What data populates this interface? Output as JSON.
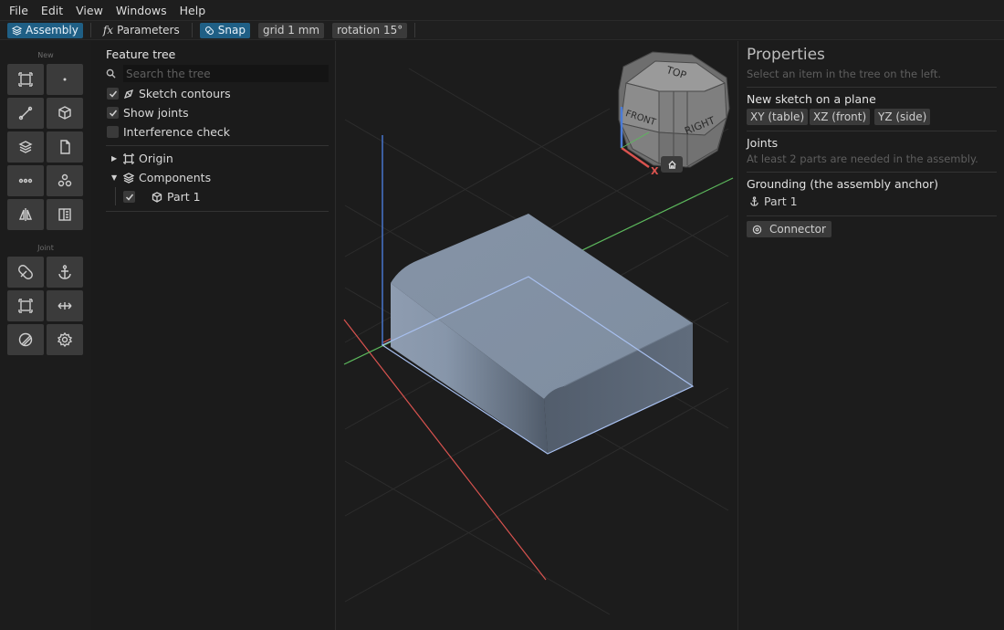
{
  "menu": [
    "File",
    "Edit",
    "View",
    "Windows",
    "Help"
  ],
  "toolbar": {
    "assembly": "Assembly",
    "parameters": "Parameters",
    "snap": "Snap",
    "grid": "grid 1 mm",
    "rotation": "rotation 15°"
  },
  "tools": {
    "section_new": "New",
    "section_joint": "Joint"
  },
  "tree": {
    "title": "Feature tree",
    "search_placeholder": "Search the tree",
    "options": [
      {
        "label": "Sketch contours",
        "checked": true
      },
      {
        "label": "Show joints",
        "checked": true
      },
      {
        "label": "Interference check",
        "checked": false
      }
    ],
    "origin": "Origin",
    "components": "Components",
    "part": "Part 1"
  },
  "viewcube": {
    "top": "TOP",
    "front": "FRONT",
    "right": "RIGHT",
    "x_axis": "X"
  },
  "properties": {
    "title": "Properties",
    "subtitle": "Select an item in the tree on the left.",
    "new_sketch": "New sketch on a plane",
    "planes": [
      "XY (table)",
      "XZ (front)",
      "YZ (side)"
    ],
    "joints_title": "Joints",
    "joints_note": "At least 2 parts are needed in the assembly.",
    "grounding_title": "Grounding (the assembly anchor)",
    "grounding_part": "Part 1",
    "connector": "Connector"
  },
  "colors": {
    "accent": "#1f5f85",
    "axis_x": "#d9534f",
    "axis_y": "#5cb85c",
    "axis_z": "#4a7bd8",
    "part": "#8a9bb0"
  }
}
